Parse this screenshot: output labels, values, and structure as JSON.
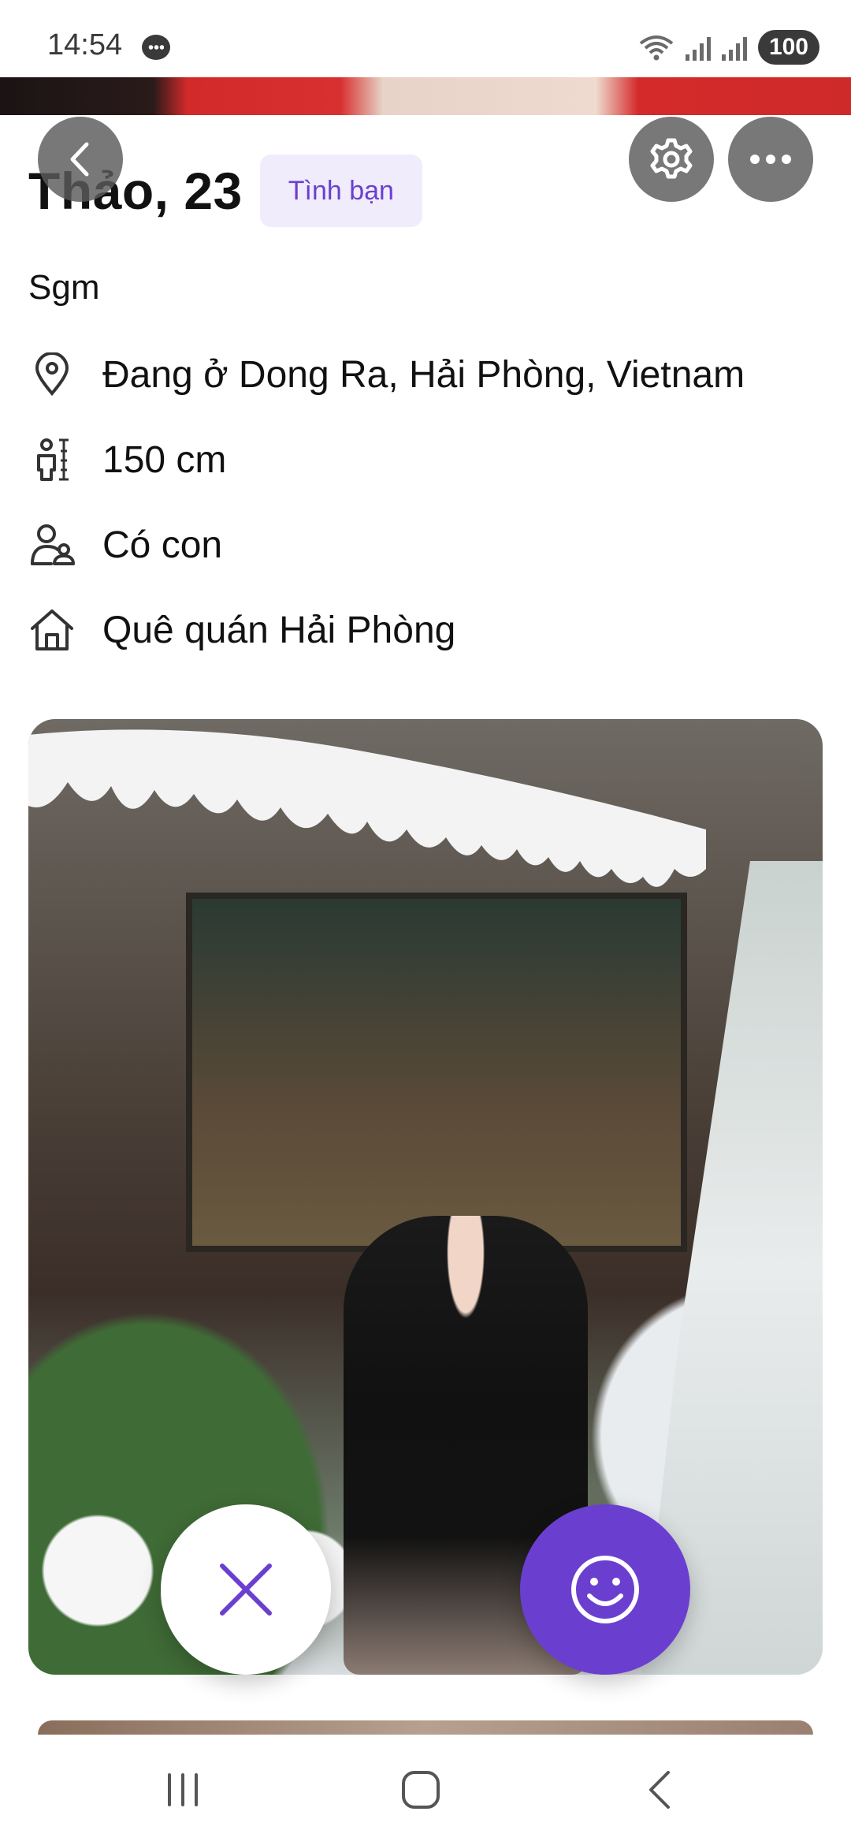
{
  "status_bar": {
    "time": "14:54",
    "battery": "100"
  },
  "profile": {
    "name_age": "Thảo, 23",
    "tag": "Tình bạn",
    "bio": "Sgm",
    "details": [
      {
        "icon": "location-pin-icon",
        "text": "Đang ở Dong Ra, Hải Phòng, Vietnam"
      },
      {
        "icon": "height-icon",
        "text": "150 cm"
      },
      {
        "icon": "children-icon",
        "text": "Có con"
      },
      {
        "icon": "home-icon",
        "text": "Quê quán Hải Phòng"
      }
    ]
  },
  "colors": {
    "accent": "#6a3fd0",
    "tag_bg": "#f1ecfb"
  }
}
